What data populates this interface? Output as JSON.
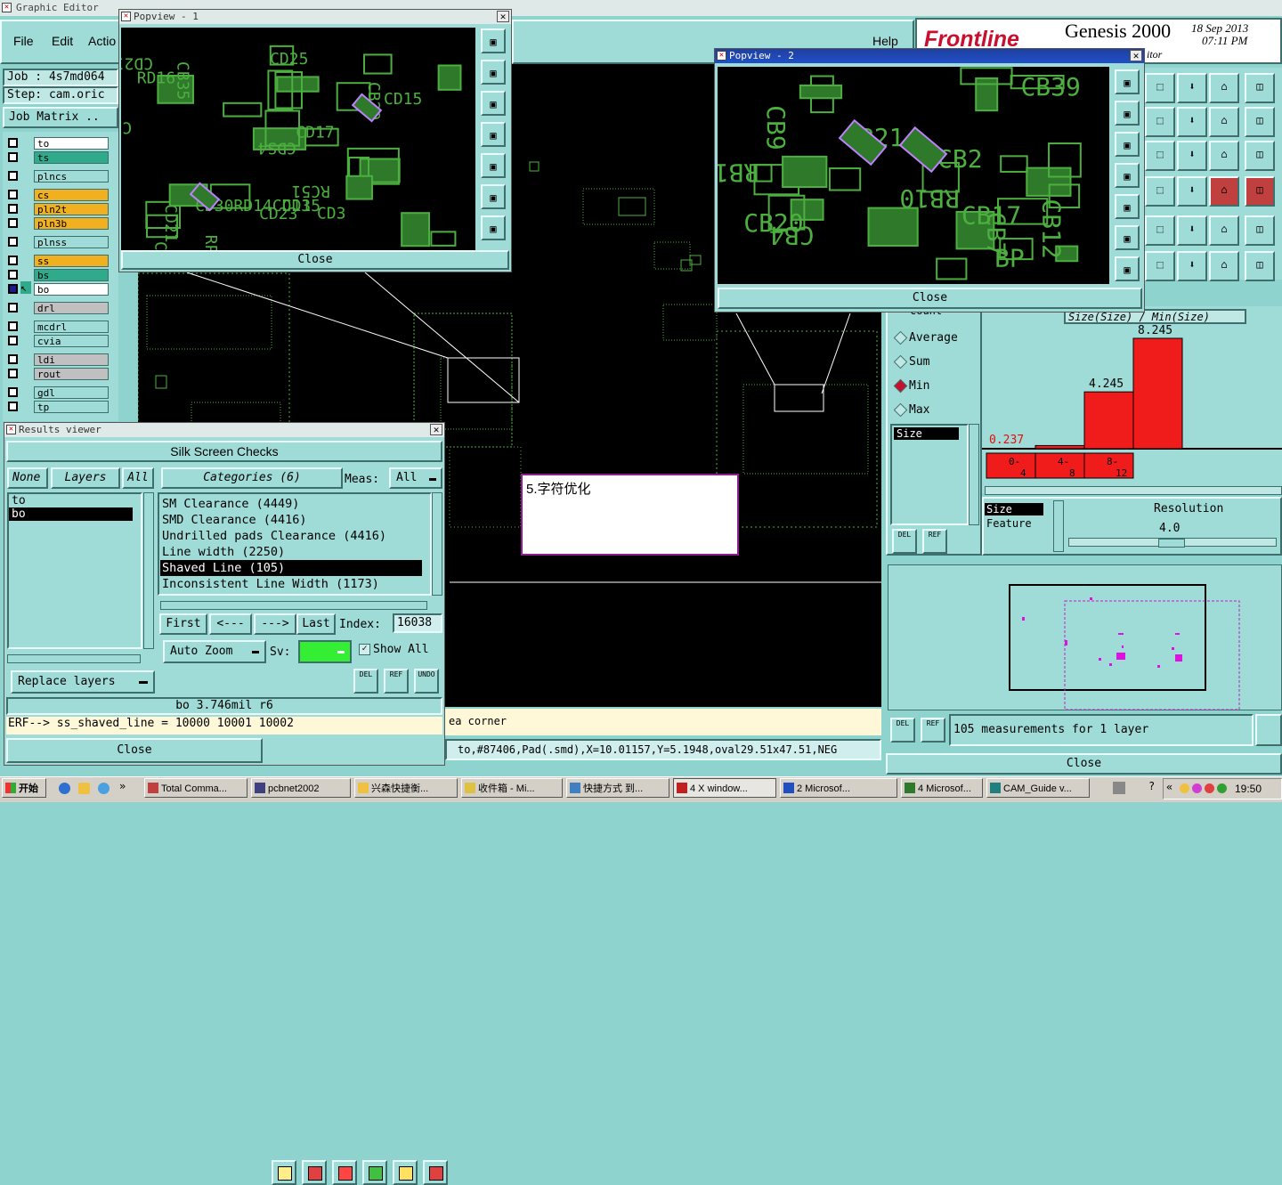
{
  "main_window": {
    "title": "Graphic Editor",
    "menu": [
      "File",
      "Edit",
      "Actio"
    ],
    "help": "Help",
    "job_label": "Job : 4s7md064",
    "step_label": "Step: cam.oric",
    "job_matrix": "Job Matrix ..",
    "brand": "Frontline",
    "product": "Genesis 2000",
    "date": "18 Sep 2013",
    "time": "07:11 PM",
    "editor": "itor"
  },
  "layers": [
    "to",
    "ts",
    "plncs",
    "cs",
    "pln2t",
    "pln3b",
    "plnss",
    "ss",
    "bs",
    "bo",
    "drl",
    "mcdrl",
    "cvia",
    "ldi",
    "rout",
    "gdl",
    "tp"
  ],
  "popview1": {
    "title": "Popview - 1",
    "close": "Close",
    "labels": [
      "RP3",
      "CB1",
      "CD17",
      "CB10",
      "CD23",
      "CDS4",
      "CD21",
      "CD15",
      "RD16",
      "RC51",
      "CD3",
      "CD30RD14CD13",
      "CB35",
      "CD21",
      "CD15",
      "CB29",
      "CD25"
    ]
  },
  "popview2": {
    "title": "Popview - 2",
    "close": "Close",
    "labels": [
      "CB7",
      "CB4",
      "CB20",
      "CB9",
      "CB2",
      "RB12",
      "CB12",
      "CB21",
      "CB39",
      "RB10",
      "CB17",
      "BP"
    ]
  },
  "results_viewer": {
    "title": "Results viewer",
    "header": "Silk Screen Checks",
    "none_btn": "None",
    "layers_btn": "Layers",
    "all_btn": "All",
    "layers": [
      "to",
      "bo"
    ],
    "selected_layer": "bo",
    "categories_btn": "Categories (6)",
    "meas_label": "Meas:",
    "meas_value": "All",
    "categories": [
      "SM Clearance (4449)",
      "SMD Clearance (4416)",
      "Undrilled pads Clearance (4416)",
      "Line width (2250)",
      "Shaved Line (105)",
      "Inconsistent Line Width (1173)"
    ],
    "selected_category": "Shaved Line (105)",
    "first": "First",
    "prev": "<---",
    "next": "--->",
    "last": "Last",
    "index_label": "Index:",
    "index_value": "16038",
    "auto_zoom": "Auto Zoom",
    "sv_label": "Sv:",
    "show_all": "Show All",
    "replace_layers": "Replace layers",
    "del": "DEL",
    "ref": "REF",
    "undo": "UNDO",
    "status": "bo 3.746mil r6",
    "erf": "ERF--> ss_shaved_line = 10000 10001 10002",
    "close": "Close"
  },
  "note": "5.字符优化",
  "status_bar": {
    "corner_text": "ea corner",
    "coords": "to,#87406,Pad(.smd),X=10.01157,Y=5.1948,oval29.51x47.51,NEG"
  },
  "stats_panel": {
    "count_label": "count",
    "options": [
      "Average",
      "Sum",
      "Min",
      "Max"
    ],
    "selected_option": "Min",
    "list_item": "Size",
    "size_item": "Size",
    "feature_item": "Feature",
    "resolution_label": "Resolution",
    "resolution_value": "4.0",
    "histogram_title": "Size(Size) / Min(Size)",
    "measurements": "105 measurements for 1 layer",
    "close": "Close",
    "del": "DEL",
    "ref": "REF"
  },
  "chart_data": {
    "type": "bar",
    "title": "Size(Size) / Min(Size)",
    "categories": [
      "0-4",
      "4-8",
      "8-12"
    ],
    "values": [
      0.237,
      4.245,
      8.245
    ],
    "value_labels": [
      "0.237",
      "4.245",
      "8.245"
    ],
    "bar_color": "#f01c1c"
  },
  "taskbar": {
    "start": "开始",
    "items": [
      "Total Comma...",
      "pcbnet2002",
      "兴森快捷衡...",
      "收件箱 - Mi...",
      "快捷方式 到...",
      "4 X window...",
      "2 Microsof...",
      "4 Microsof...",
      "CAM_Guide v..."
    ],
    "clock": "19:50"
  },
  "colors": {
    "panel": "#9fdcd8",
    "board": "#000000",
    "trace": "#4caf3f",
    "highlight": "#c080ff",
    "selection": "#e010e0"
  }
}
